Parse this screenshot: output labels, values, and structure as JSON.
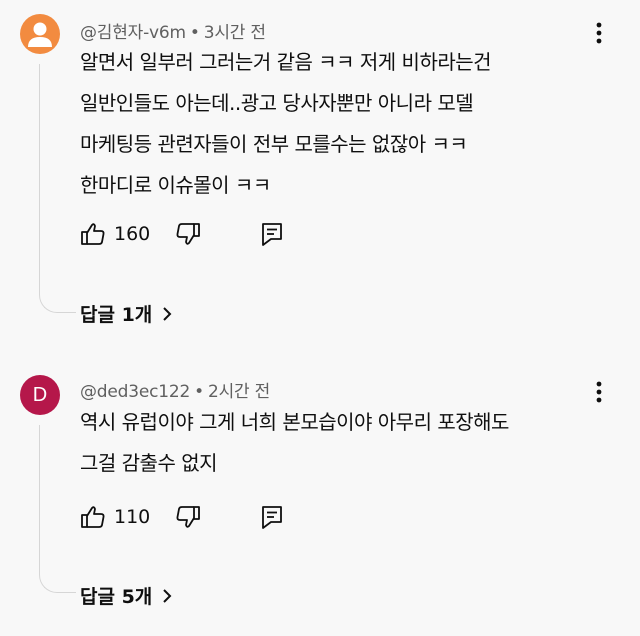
{
  "comments": [
    {
      "author": "@김현자-v6m",
      "time": "3시간 전",
      "text": "알면서 일부러 그러는거 같음 ㅋㅋ 저게 비하라는건\n일반인들도 아는데..광고 당사자뿐만 아니라 모델\n마케팅등 관련자들이 전부 모를수는 없잖아 ㅋㅋ\n한마디로 이슈몰이 ㅋㅋ",
      "likes": "160",
      "replies_label": "답글 1개",
      "avatar_color": "#f28b40"
    },
    {
      "author": "@ded3ec122",
      "time": "2시간 전",
      "text": "역시 유럽이야 그게 너희 본모습이야 아무리 포장해도\n그걸 감출수 없지",
      "likes": "110",
      "replies_label": "답글 5개",
      "avatar_letter": "D",
      "avatar_color": "#b5174a"
    }
  ],
  "icons": {
    "like": "thumbs-up-icon",
    "dislike": "thumbs-down-icon",
    "reply": "reply-icon",
    "more": "more-vert-icon",
    "expand": "chevron-right-icon"
  }
}
